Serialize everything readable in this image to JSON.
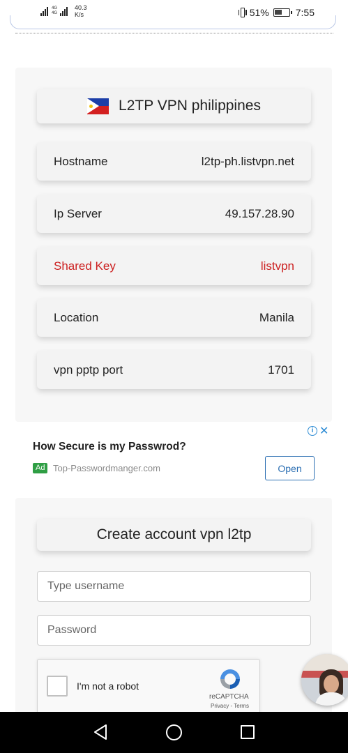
{
  "status_bar": {
    "network_tag_top": "4G",
    "network_tag_bottom": "4G",
    "speed_value": "40.3",
    "speed_unit": "K/s",
    "battery": "51%",
    "battery_level_fraction": 0.51,
    "time": "7:55"
  },
  "server_card": {
    "title": "L2TP VPN philippines",
    "flag_icon": "philippines-flag-icon",
    "rows": [
      {
        "label": "Hostname",
        "value": "l2tp-ph.listvpn.net"
      },
      {
        "label": "Ip Server",
        "value": "49.157.28.90"
      },
      {
        "label": "Shared Key",
        "value": "listvpn",
        "color": "#cc1f1f"
      },
      {
        "label": "Location",
        "value": "Manila"
      },
      {
        "label": "vpn pptp port",
        "value": "1701"
      }
    ]
  },
  "ad": {
    "title": "How Secure is my Passwrod?",
    "badge": "Ad",
    "url": "Top-Passwordmanger.com",
    "open_label": "Open",
    "info_icon": "info-icon",
    "close_icon": "close-icon"
  },
  "create_card": {
    "title": "Create account vpn l2tp",
    "username_placeholder": "Type username",
    "password_placeholder": "Password",
    "recaptcha": {
      "label": "I'm not a robot",
      "brand": "reCAPTCHA",
      "terms": "Privacy - Terms"
    }
  },
  "colors": {
    "accent_red": "#cc1f1f",
    "ad_blue": "#2c6fb3",
    "ad_badge_green": "#2f9e44"
  }
}
